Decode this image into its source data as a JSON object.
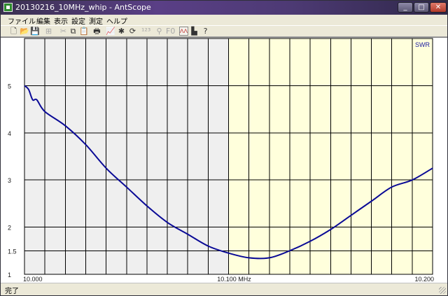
{
  "window": {
    "title": "20130216_10MHz_whip - AntScope",
    "minimize_glyph": "_",
    "maximize_glyph": "□",
    "close_glyph": "✕"
  },
  "menu": [
    "ファイル",
    "編集",
    "表示",
    "設定",
    "測定",
    "ヘルプ"
  ],
  "toolbar": [
    {
      "icon": "new-file-icon",
      "glyph": "🗋",
      "enabled": true
    },
    {
      "icon": "open-folder-icon",
      "glyph": "📂",
      "enabled": true
    },
    {
      "icon": "save-icon",
      "glyph": "💾",
      "enabled": true
    },
    {
      "icon": "insert-icon",
      "glyph": "⊞",
      "enabled": false
    },
    {
      "icon": "cut-icon",
      "glyph": "✂",
      "enabled": false
    },
    {
      "icon": "copy-icon",
      "glyph": "⧉",
      "enabled": true
    },
    {
      "icon": "paste-icon",
      "glyph": "📋",
      "enabled": true
    },
    {
      "icon": "print-icon",
      "glyph": "🖶",
      "enabled": true
    },
    {
      "icon": "graph-icon",
      "glyph": "📈",
      "enabled": false
    },
    {
      "icon": "sweep-icon",
      "glyph": "✱",
      "enabled": true
    },
    {
      "icon": "refresh-icon",
      "glyph": "⟳",
      "enabled": true
    },
    {
      "icon": "counter-icon",
      "glyph": "¹²³",
      "enabled": false
    },
    {
      "icon": "antenna-icon",
      "glyph": "⚲",
      "enabled": false
    },
    {
      "icon": "frequency-icon",
      "glyph": "F0",
      "enabled": false
    },
    {
      "icon": "swr-mode-icon",
      "glyph": "ᐱᐱ",
      "enabled": true,
      "pressed": true
    },
    {
      "icon": "chart-icon",
      "glyph": "▙",
      "enabled": true
    },
    {
      "icon": "help-icon",
      "glyph": "?",
      "enabled": true
    }
  ],
  "status": "完了",
  "colors": {
    "out_of_band_bg": "#efefef",
    "in_band_bg": "#ffffdc",
    "grid": "#000000",
    "curve": "#0a0a96",
    "label": "#1a1a1a",
    "swr_label": "#1a1aa0"
  },
  "chart_data": {
    "type": "line",
    "series_label": "SWR",
    "x_tick_labels": [
      "10.000",
      "10.100 MHz",
      "10.200"
    ],
    "x_ticks": [
      10.0,
      10.1,
      10.2
    ],
    "y_tick_labels": [
      "1",
      "1.5",
      "2",
      "3",
      "4",
      "5"
    ],
    "y_ticks": [
      1,
      1.5,
      2,
      3,
      4,
      5
    ],
    "xlim": [
      10.0,
      10.2
    ],
    "ylim": [
      1.0,
      6.0
    ],
    "band_highlight": [
      10.1,
      10.2
    ],
    "grid": true,
    "x": [
      10.0,
      10.002,
      10.004,
      10.006,
      10.01,
      10.02,
      10.03,
      10.04,
      10.05,
      10.06,
      10.07,
      10.08,
      10.09,
      10.1,
      10.11,
      10.12,
      10.13,
      10.14,
      10.15,
      10.16,
      10.17,
      10.18,
      10.19,
      10.2
    ],
    "y": [
      5.0,
      4.92,
      4.7,
      4.7,
      4.45,
      4.15,
      3.75,
      3.25,
      2.85,
      2.45,
      2.1,
      1.85,
      1.6,
      1.45,
      1.35,
      1.35,
      1.5,
      1.7,
      1.95,
      2.25,
      2.55,
      2.85,
      3.0,
      3.25
    ]
  }
}
